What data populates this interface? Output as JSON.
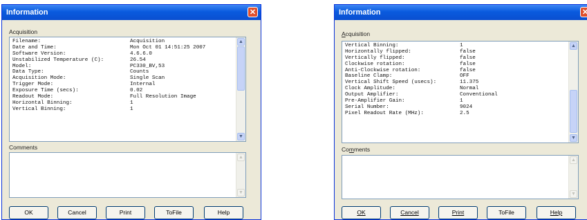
{
  "left": {
    "title": "Information",
    "acquisition_label": "Acquisition",
    "rows": [
      {
        "key": "Filename:",
        "value": "Acquisition"
      },
      {
        "key": "Date and Time:",
        "value": "Mon Oct 01 14:51:25 2007"
      },
      {
        "key": "Software Version:",
        "value": "4.6.6.0"
      },
      {
        "key": "Unstabilized Temperature (C):",
        "value": "26.54"
      },
      {
        "key": "Model:",
        "value": "PC330_BV,53"
      },
      {
        "key": "Data Type:",
        "value": "Counts"
      },
      {
        "key": "Acquisition Mode:",
        "value": "Single Scan"
      },
      {
        "key": "Trigger Mode:",
        "value": "Internal"
      },
      {
        "key": "Exposure Time (secs):",
        "value": "0.02"
      },
      {
        "key": "Readout Mode:",
        "value": "Full Resolution Image"
      },
      {
        "key": "Horizontal Binning:",
        "value": "1"
      },
      {
        "key": "Vertical Binning:",
        "value": "1"
      }
    ],
    "comments_label": "Comments",
    "buttons": {
      "ok": "OK",
      "cancel": "Cancel",
      "print": "Print",
      "tofile": "ToFile",
      "help": "Help"
    }
  },
  "right": {
    "title": "Information",
    "acquisition_label": "Acquisition",
    "rows": [
      {
        "key": "Vertical Binning:",
        "value": "1"
      },
      {
        "key": "Horizontally flipped:",
        "value": "false"
      },
      {
        "key": "Vertically flipped:",
        "value": "false"
      },
      {
        "key": "Clockwise rotation:",
        "value": "false"
      },
      {
        "key": "Anti-Clockwise rotation:",
        "value": "false"
      },
      {
        "key": "Baseline Clamp:",
        "value": "OFF"
      },
      {
        "key": "Vertical Shift Speed (usecs):",
        "value": "11.375"
      },
      {
        "key": "Clock Amplitude:",
        "value": "Normal"
      },
      {
        "key": "Output Amplifier:",
        "value": "Conventional"
      },
      {
        "key": "Pre-Amplifier Gain:",
        "value": "1"
      },
      {
        "key": "Serial Number:",
        "value": "9024"
      },
      {
        "key": "Pixel Readout Rate (MHz):",
        "value": "2.5"
      }
    ],
    "comments_label": "Comments",
    "buttons": {
      "ok": "OK",
      "cancel": "Cancel",
      "print": "Print",
      "tofile": "ToFile",
      "help": "Help"
    }
  }
}
